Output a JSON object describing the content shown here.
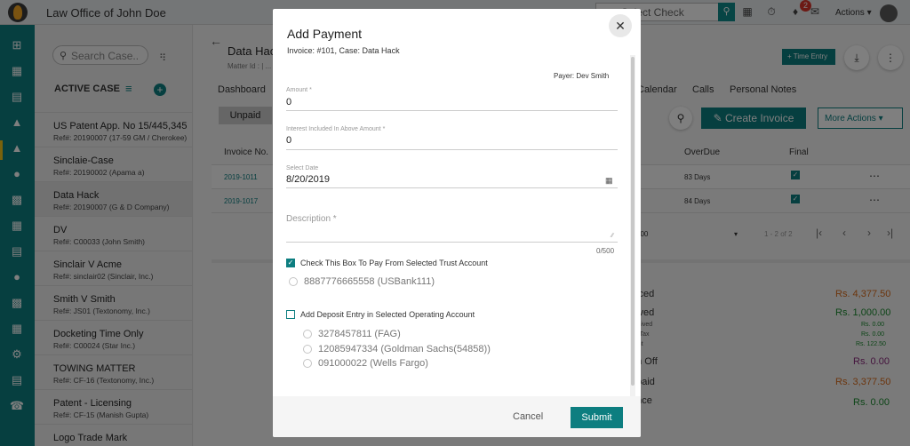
{
  "header": {
    "app_title": "Law Office of John Doe",
    "search_placeholder": "Select Check",
    "notification_count": "2",
    "actions_label": "Actions"
  },
  "icons": {
    "logo": "flame-logo-icon",
    "search": "search-icon",
    "calendar": "calendar-icon",
    "timer": "timer-icon",
    "notifications": "bell-icon",
    "messages": "mail-icon",
    "user": "avatar-icon"
  },
  "colors": {
    "brand_teal": "#0d7e80",
    "warning_orange": "#f5a623",
    "badge_red": "#d9342b",
    "amount_green": "#1a8a2e",
    "amount_purple": "#8a2a7c",
    "amount_orange": "#d96a1a"
  },
  "case_panel": {
    "search_placeholder": "Search Case..",
    "active_case_label": "ACTIVE CASE",
    "cases": [
      {
        "name": "US Patent App. No 15/445,345",
        "ref": "Ref#: 20190007 (17-59 GM / Cherokee)"
      },
      {
        "name": "Sinclaie-Case",
        "ref": "Ref#: 20190002 (Apama a)"
      },
      {
        "name": "Data Hack",
        "ref": "Ref#: 20190007 (G & D Company)"
      },
      {
        "name": "DV",
        "ref": "Ref#: C00033 (John Smith)"
      },
      {
        "name": "Sinclair V Acme",
        "ref": "Ref#: sinclair02 (Sinclair, Inc.)"
      },
      {
        "name": "Smith V Smith",
        "ref": "Ref#: JS01 (Textonomy, Inc.)"
      },
      {
        "name": "Docketing Time Only",
        "ref": "Ref#: C00024 (Star Inc.)"
      },
      {
        "name": "TOWING MATTER",
        "ref": "Ref#: CF-16 (Textonomy, Inc.)"
      },
      {
        "name": "Patent - Licensing",
        "ref": "Ref#: CF-15 (Manish Gupta)"
      },
      {
        "name": "Logo Trade Mark",
        "ref": ""
      }
    ]
  },
  "main": {
    "case_title": "Data Hack",
    "matter_id": "Matter Id : | ...",
    "tabs": [
      "Dashboard",
      "Calendar",
      "Calls",
      "Personal Notes"
    ],
    "time_entry_label": "Time Entry",
    "filter_unpaid": "Unpaid",
    "create_invoice_label": "Create Invoice",
    "more_actions_label": "More Actions",
    "table_headers": {
      "invoice_no": "Invoice No.",
      "overdue": "OverDue",
      "final": "Final"
    },
    "rows": [
      {
        "invoice": "2019-1011",
        "overdue": "83 Days"
      },
      {
        "invoice": "2019-1017",
        "overdue": "84 Days"
      }
    ],
    "pagination": {
      "per_page": "100",
      "range": "1 - 2 of 2"
    },
    "summary": [
      {
        "label": "oiced",
        "value": "Rs. 4,377.50"
      },
      {
        "label": "eived",
        "value": "Rs. 1,000.00"
      },
      {
        "label": "eceived",
        "value": "Rs. 0.00"
      },
      {
        "label": "ral Tax",
        "value": "Rs. 0.00"
      },
      {
        "label": "ount",
        "value": "Rs. 122.50"
      },
      {
        "label": "en Off",
        "value": "Rs. 0.00"
      },
      {
        "label": "npaid",
        "value": "Rs. 3,377.50"
      },
      {
        "label": "ance",
        "value": "Rs. 0.00"
      }
    ]
  },
  "modal": {
    "title": "Add Payment",
    "subtitle": "Invoice: #101, Case: Data Hack",
    "payer": "Payer: Dev Smith",
    "amount_label": "Amount *",
    "amount_value": "0",
    "interest_label": "Interest Included In Above Amount *",
    "interest_value": "0",
    "date_label": "Select Date",
    "date_value": "8/20/2019",
    "description_placeholder": "Description *",
    "char_count": "0/500",
    "trust_checkbox_label": "Check This Box To Pay From Selected Trust Account",
    "trust_checked": true,
    "trust_accounts": [
      "8887776665558 (USBank111)"
    ],
    "deposit_checkbox_label": "Add Deposit Entry in Selected Operating Account",
    "deposit_checked": false,
    "operating_accounts": [
      "3278457811 (FAG)",
      "12085947334 (Goldman Sachs(54858))",
      "091000022 (Wells Fargo)"
    ],
    "cancel_label": "Cancel",
    "submit_label": "Submit"
  }
}
